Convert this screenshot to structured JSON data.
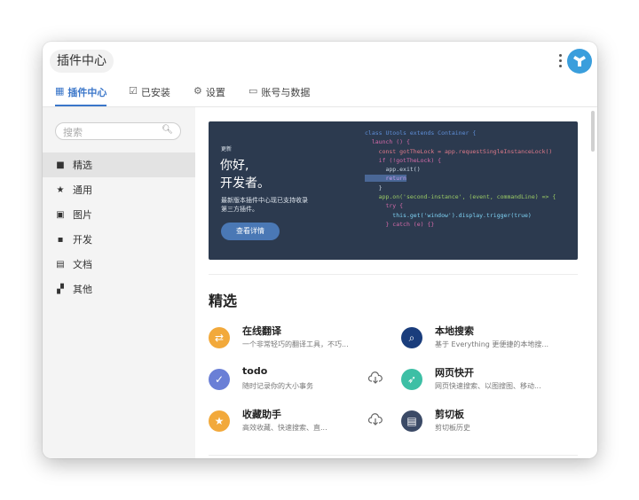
{
  "header": {
    "title": "插件中心"
  },
  "tabs": [
    {
      "icon": "▦",
      "label": "插件中心"
    },
    {
      "icon": "☑",
      "label": "已安装"
    },
    {
      "icon": "⚙",
      "label": "设置"
    },
    {
      "icon": "▭",
      "label": "账号与数据"
    }
  ],
  "sidebar": {
    "search_placeholder": "搜索",
    "items": [
      {
        "icon": "🎁",
        "label": "精选"
      },
      {
        "icon": "★",
        "label": "通用"
      },
      {
        "icon": "▣",
        "label": "图片"
      },
      {
        "icon": "▪",
        "label": "开发"
      },
      {
        "icon": "▤",
        "label": "文档"
      },
      {
        "icon": "▞",
        "label": "其他"
      }
    ]
  },
  "banner": {
    "tag": "更新",
    "title_line1": "你好,",
    "title_line2": "开发者。",
    "desc_line1": "最新版本插件中心现已支持收录",
    "desc_line2": "第三方插件。",
    "button": "查看详情",
    "code": [
      "class Utools extends Container {",
      "  launch () {",
      "    const gotTheLock = app.requestSingleInstanceLock()",
      "    if (!gotTheLock) {",
      "      app.exit()",
      "      return",
      "    }",
      "    app.on('second-instance', (event, commandLine) => {",
      "      try {",
      "        this.get('window').display.trigger(true)",
      "      } catch (e) {}"
    ]
  },
  "section": {
    "title": "精选"
  },
  "plugins": [
    {
      "name": "在线翻译",
      "desc": "一个非常轻巧的翻译工具，不巧...",
      "icon": "translate-icon",
      "color": "#f2a93b",
      "glyph": "⇄",
      "download": false
    },
    {
      "name": "本地搜索",
      "desc": "基于 Everything 更便捷的本地搜...",
      "icon": "search-icon",
      "color": "#1a3d7c",
      "glyph": "⌕",
      "download": false
    },
    {
      "name": "todo",
      "desc": "随时记录你的大小事务",
      "icon": "check-icon",
      "color": "#6a7fd6",
      "glyph": "✓",
      "download": true
    },
    {
      "name": "网页快开",
      "desc": "网页快速搜索、以图搜图、移动...",
      "icon": "rocket-icon",
      "color": "#3dbfa5",
      "glyph": "➶",
      "download": false
    },
    {
      "name": "收藏助手",
      "desc": "高效收藏、快速搜索、直...",
      "icon": "star-icon",
      "color": "#f2a93b",
      "glyph": "★",
      "download": true
    },
    {
      "name": "剪切板",
      "desc": "剪切板历史",
      "icon": "clipboard-icon",
      "color": "#3b4a66",
      "glyph": "▤",
      "download": false
    }
  ]
}
